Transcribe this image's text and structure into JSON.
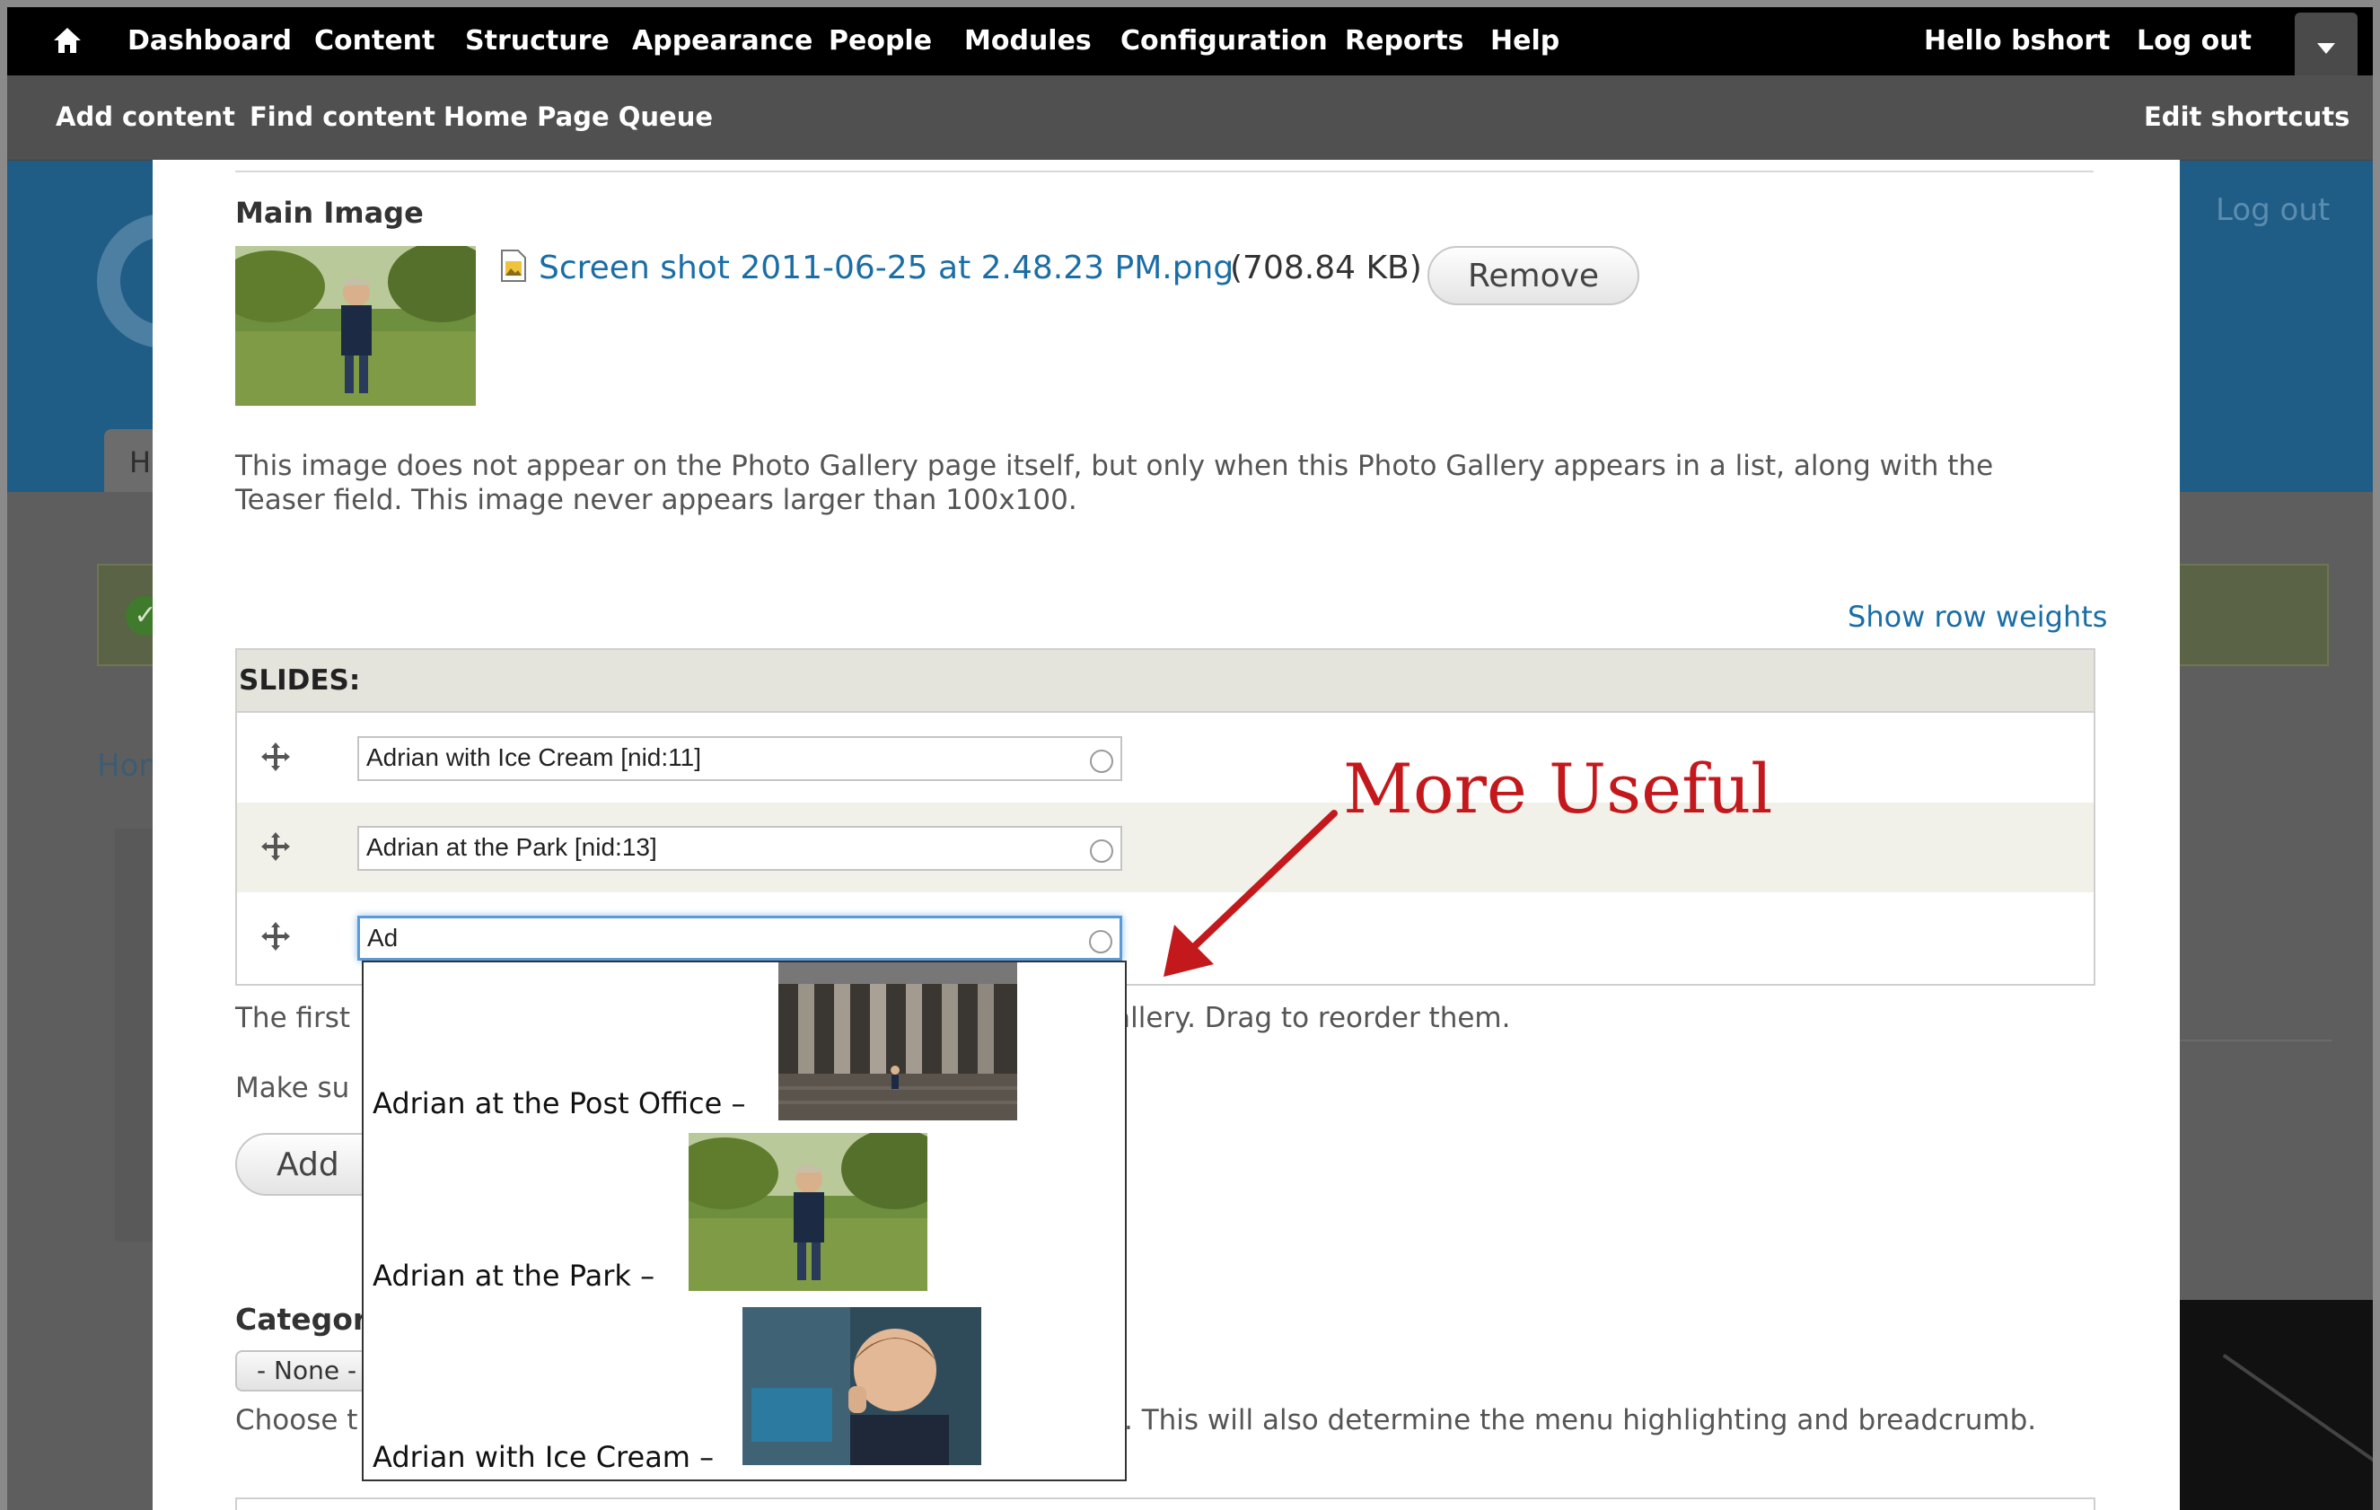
{
  "toolbar": {
    "items": [
      "Dashboard",
      "Content",
      "Structure",
      "Appearance",
      "People",
      "Modules",
      "Configuration",
      "Reports",
      "Help"
    ],
    "hello_prefix": "Hello ",
    "username": "bshort",
    "logout": "Log out"
  },
  "shortcuts": {
    "items": [
      "Add content",
      "Find content",
      "Home Page Queue"
    ],
    "edit": "Edit shortcuts"
  },
  "background": {
    "logout": "Log out",
    "tab_fragment": "Ho",
    "breadcrumb_fragment": "Hom"
  },
  "main_image": {
    "label": "Main Image",
    "filename": "Screen shot 2011-06-25 at 2.48.23 PM.png",
    "filesize": "(708.84 KB)",
    "remove_label": "Remove",
    "description": "This image does not appear on the Photo Gallery page itself, but only when this Photo Gallery appears in a list, along with the Teaser field. This image never appears larger than 100x100."
  },
  "slides": {
    "show_weights": "Show row weights",
    "header": "SLIDES:",
    "rows": [
      {
        "value": "Adrian with Ice Cream [nid:11]"
      },
      {
        "value": "Adrian at the Park [nid:13]"
      },
      {
        "value": "Ad"
      }
    ],
    "description_start": "The first",
    "description_end": "Gallery. Drag to reorder them.",
    "make_sure": "Make su",
    "add_label": "Add"
  },
  "autocomplete": {
    "items": [
      {
        "label": "Adrian at the Post Office  –"
      },
      {
        "label": "Adrian at the Park  –"
      },
      {
        "label": "Adrian with Ice Cream  –"
      }
    ]
  },
  "category": {
    "label": "Categor",
    "selected": "- None -",
    "description_start": "Choose t",
    "description_end": ". This will also determine the menu highlighting and breadcrumb."
  },
  "annotation": {
    "text": "More Useful",
    "color": "#c4191c"
  },
  "colors": {
    "toolbar": "#000000",
    "link": "#1a6ea6",
    "header_blue": "#1f5d86"
  }
}
